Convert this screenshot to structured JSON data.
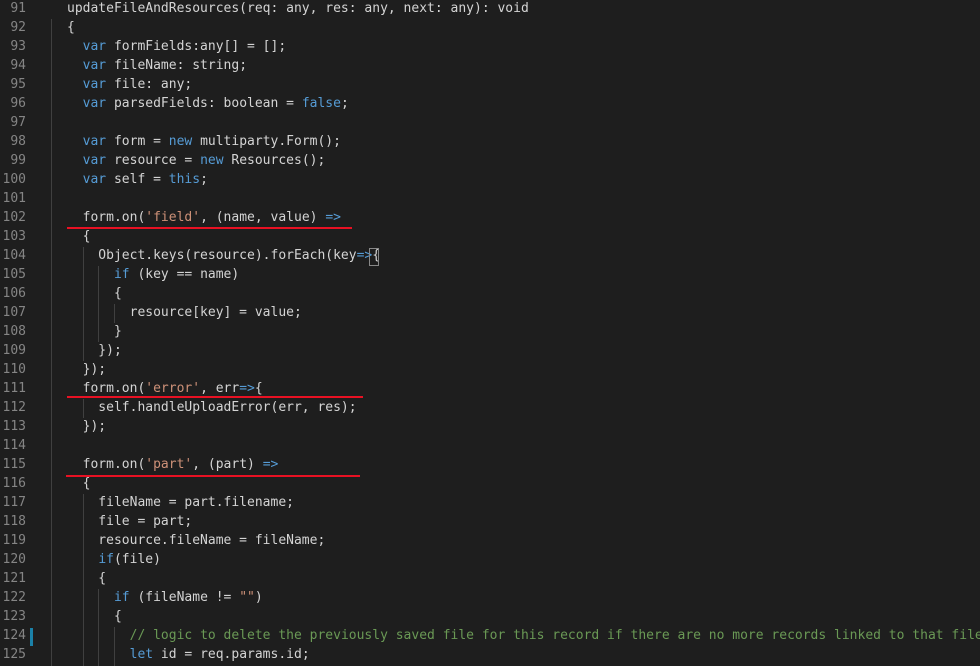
{
  "editor": {
    "colors": {
      "background": "#1e1e1e",
      "line_number": "#858585",
      "default": "#d4d4d4",
      "keyword": "#569cd6",
      "type": "#4ec9b0",
      "string": "#ce9178",
      "comment": "#6a9955",
      "variable": "#9cdcfe",
      "function": "#dcdcaa",
      "annotation_underline": "#e81123",
      "modified_marker": "#1b81a8"
    },
    "lines": [
      {
        "num": "91",
        "tokens": [
          {
            "t": "updateFileAndResources(req: any, res: any, next: any): void",
            "c": "default"
          }
        ]
      },
      {
        "num": "92",
        "tokens": [
          {
            "t": "{",
            "c": "default"
          }
        ]
      },
      {
        "num": "93",
        "tokens": [
          {
            "t": "  ",
            "c": "default"
          },
          {
            "t": "var",
            "c": "keyword"
          },
          {
            "t": " formFields",
            "c": "default"
          },
          {
            "t": ":any[] = [];",
            "c": "default"
          }
        ]
      },
      {
        "num": "94",
        "tokens": [
          {
            "t": "  ",
            "c": "default"
          },
          {
            "t": "var",
            "c": "keyword"
          },
          {
            "t": " fileName: string;",
            "c": "default"
          }
        ]
      },
      {
        "num": "95",
        "tokens": [
          {
            "t": "  ",
            "c": "default"
          },
          {
            "t": "var",
            "c": "keyword"
          },
          {
            "t": " file: any;",
            "c": "default"
          }
        ]
      },
      {
        "num": "96",
        "tokens": [
          {
            "t": "  ",
            "c": "default"
          },
          {
            "t": "var",
            "c": "keyword"
          },
          {
            "t": " parsedFields: boolean = ",
            "c": "default"
          },
          {
            "t": "false",
            "c": "keyword"
          },
          {
            "t": ";",
            "c": "default"
          }
        ]
      },
      {
        "num": "97",
        "tokens": []
      },
      {
        "num": "98",
        "tokens": [
          {
            "t": "  ",
            "c": "default"
          },
          {
            "t": "var",
            "c": "keyword"
          },
          {
            "t": " form = ",
            "c": "default"
          },
          {
            "t": "new",
            "c": "keyword"
          },
          {
            "t": " multiparty.Form();",
            "c": "default"
          }
        ]
      },
      {
        "num": "99",
        "tokens": [
          {
            "t": "  ",
            "c": "default"
          },
          {
            "t": "var",
            "c": "keyword"
          },
          {
            "t": " resource = ",
            "c": "default"
          },
          {
            "t": "new",
            "c": "keyword"
          },
          {
            "t": " Resources();",
            "c": "default"
          }
        ]
      },
      {
        "num": "100",
        "tokens": [
          {
            "t": "  ",
            "c": "default"
          },
          {
            "t": "var",
            "c": "keyword"
          },
          {
            "t": " self = ",
            "c": "default"
          },
          {
            "t": "this",
            "c": "keyword"
          },
          {
            "t": ";",
            "c": "default"
          }
        ]
      },
      {
        "num": "101",
        "tokens": []
      },
      {
        "num": "102",
        "tokens": [
          {
            "t": "  form.on(",
            "c": "default"
          },
          {
            "t": "'field'",
            "c": "string"
          },
          {
            "t": ", (name, value) ",
            "c": "default"
          },
          {
            "t": "=>",
            "c": "keyword"
          }
        ]
      },
      {
        "num": "103",
        "tokens": [
          {
            "t": "  {",
            "c": "default"
          }
        ]
      },
      {
        "num": "104",
        "tokens": [
          {
            "t": "    Object.keys(resource).forEach(key",
            "c": "default"
          },
          {
            "t": "=>",
            "c": "keyword"
          },
          {
            "t": "{",
            "c": "default"
          }
        ]
      },
      {
        "num": "105",
        "tokens": [
          {
            "t": "      ",
            "c": "default"
          },
          {
            "t": "if",
            "c": "keyword"
          },
          {
            "t": " (key == name)",
            "c": "default"
          }
        ]
      },
      {
        "num": "106",
        "tokens": [
          {
            "t": "      {",
            "c": "default"
          }
        ]
      },
      {
        "num": "107",
        "tokens": [
          {
            "t": "        resource[key] = value;",
            "c": "default"
          }
        ]
      },
      {
        "num": "108",
        "tokens": [
          {
            "t": "      }",
            "c": "default"
          }
        ]
      },
      {
        "num": "109",
        "tokens": [
          {
            "t": "    });",
            "c": "default"
          }
        ]
      },
      {
        "num": "110",
        "tokens": [
          {
            "t": "  });",
            "c": "default"
          }
        ]
      },
      {
        "num": "111",
        "tokens": [
          {
            "t": "  form.on(",
            "c": "default"
          },
          {
            "t": "'error'",
            "c": "string"
          },
          {
            "t": ", err",
            "c": "default"
          },
          {
            "t": "=>",
            "c": "keyword"
          },
          {
            "t": "{",
            "c": "default"
          }
        ]
      },
      {
        "num": "112",
        "tokens": [
          {
            "t": "    self.handleUploadError(err, res);",
            "c": "default"
          }
        ]
      },
      {
        "num": "113",
        "tokens": [
          {
            "t": "  });",
            "c": "default"
          }
        ]
      },
      {
        "num": "114",
        "tokens": []
      },
      {
        "num": "115",
        "tokens": [
          {
            "t": "  form.on(",
            "c": "default"
          },
          {
            "t": "'part'",
            "c": "string"
          },
          {
            "t": ", (part) ",
            "c": "default"
          },
          {
            "t": "=>",
            "c": "keyword"
          }
        ]
      },
      {
        "num": "116",
        "tokens": [
          {
            "t": "  {",
            "c": "default"
          }
        ]
      },
      {
        "num": "117",
        "tokens": [
          {
            "t": "    fileName = part.filename;",
            "c": "default"
          }
        ]
      },
      {
        "num": "118",
        "tokens": [
          {
            "t": "    file = part;",
            "c": "default"
          }
        ]
      },
      {
        "num": "119",
        "tokens": [
          {
            "t": "    resource.fileName = fileName;",
            "c": "default"
          }
        ]
      },
      {
        "num": "120",
        "tokens": [
          {
            "t": "    ",
            "c": "default"
          },
          {
            "t": "if",
            "c": "keyword"
          },
          {
            "t": "(file)",
            "c": "default"
          }
        ]
      },
      {
        "num": "121",
        "tokens": [
          {
            "t": "    {",
            "c": "default"
          }
        ]
      },
      {
        "num": "122",
        "tokens": [
          {
            "t": "      ",
            "c": "default"
          },
          {
            "t": "if",
            "c": "keyword"
          },
          {
            "t": " (fileName != ",
            "c": "default"
          },
          {
            "t": "\"\"",
            "c": "string"
          },
          {
            "t": ")",
            "c": "default"
          }
        ]
      },
      {
        "num": "123",
        "tokens": [
          {
            "t": "      {",
            "c": "default"
          }
        ]
      },
      {
        "num": "124",
        "tokens": [
          {
            "t": "        ",
            "c": "default"
          },
          {
            "t": "// logic to delete the previously saved file for this record if there are no more records linked to that file",
            "c": "comment"
          }
        ]
      },
      {
        "num": "125",
        "tokens": [
          {
            "t": "        ",
            "c": "default"
          },
          {
            "t": "let",
            "c": "keyword"
          },
          {
            "t": " id = req.params.id;",
            "c": "default"
          }
        ]
      }
    ]
  }
}
